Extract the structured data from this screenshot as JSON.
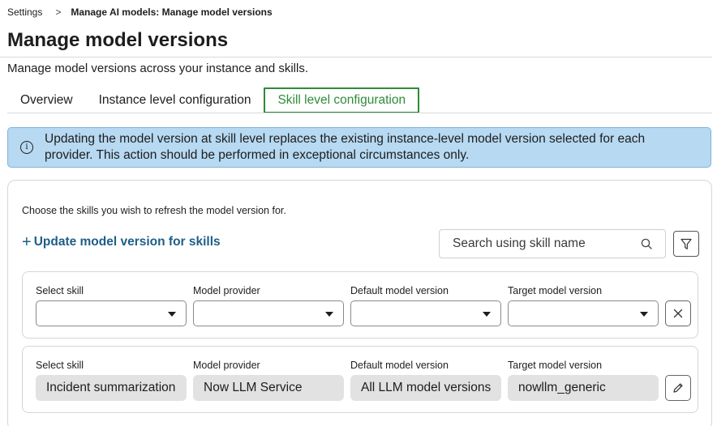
{
  "breadcrumb": {
    "root": "Settings",
    "separator": ">",
    "current": "Manage AI models: Manage model versions"
  },
  "page": {
    "title": "Manage model versions",
    "subtitle": "Manage model versions across your instance and skills."
  },
  "tabs": [
    {
      "label": "Overview",
      "active": false
    },
    {
      "label": "Instance level configuration",
      "active": false
    },
    {
      "label": "Skill level configuration",
      "active": true
    }
  ],
  "alert": {
    "icon": "info-icon",
    "text": "Updating the model version at skill level replaces the existing instance-level model version selected for each provider. This action should be performed in exceptional circumstances only."
  },
  "card": {
    "intro": "Choose the skills you wish to refresh the model version for.",
    "add_label": "Update model version for skills",
    "search_placeholder": "Search using skill name"
  },
  "columns": {
    "skill": "Select skill",
    "provider": "Model provider",
    "default_version": "Default model version",
    "target_version": "Target model version"
  },
  "rows": [
    {
      "skill": "",
      "provider": "",
      "default_version": "",
      "target_version": "",
      "action_icon": "close-icon"
    },
    {
      "skill": "Incident summarization",
      "provider": "Now LLM Service",
      "default_version": "All LLM model versions",
      "target_version": "nowllm_generic",
      "action_icon": "edit-icon"
    }
  ],
  "colors": {
    "active_tab": "#2e8b3a",
    "alert_bg": "#b7d9f2",
    "link": "#1f5e86",
    "readonly_bg": "#e2e2e2"
  }
}
